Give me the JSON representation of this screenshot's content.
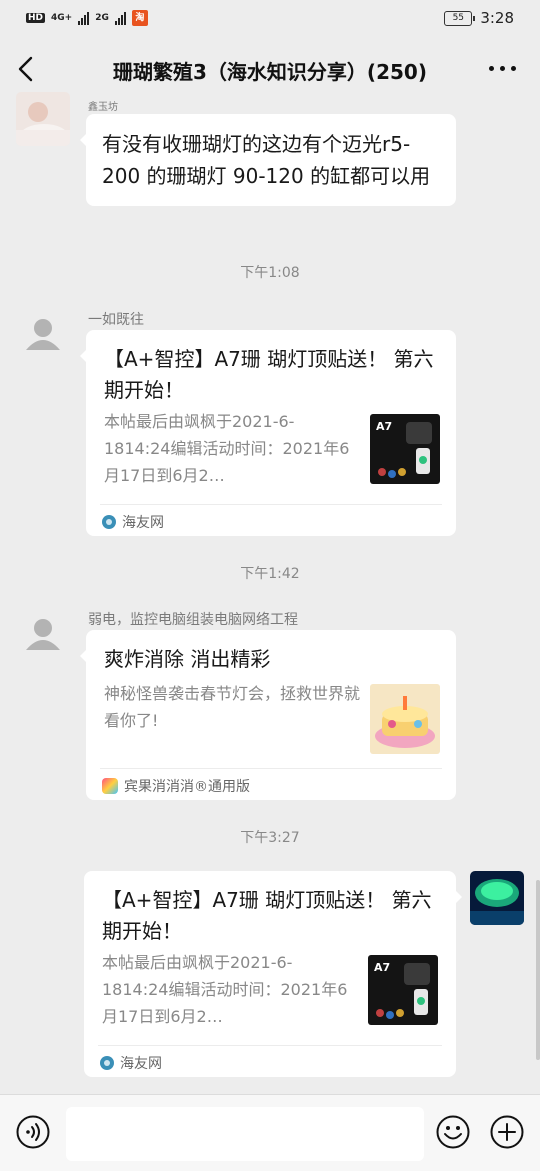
{
  "status_bar": {
    "hd_label": "HD",
    "net1": "4G+",
    "net2": "2G",
    "battery": "55",
    "time": "3:28"
  },
  "header": {
    "title": "珊瑚繁殖3（海水知识分享）(250)",
    "back_icon": "back-arrow-icon",
    "more_icon": "more-dots-icon"
  },
  "messages": [
    {
      "type": "text",
      "sender_name": "鑫玉坊",
      "text": "有没有收珊瑚灯的这边有个迈光r5-200 的珊瑚灯 90-120 的缸都可以用"
    },
    {
      "type": "time",
      "text": "下午1:08"
    },
    {
      "type": "card",
      "sender_name": "一如既往",
      "title": "【A+智控】A7珊 瑚灯顶贴送！ 第六期开始！",
      "desc": "本帖最后由飒枫于2021-6-1814:24编辑活动时间：2021年6月17日到6月2…",
      "thumb_label": "A7",
      "source": "海友网"
    },
    {
      "type": "time",
      "text": "下午1:42"
    },
    {
      "type": "card",
      "sender_name": "弱电，监控电脑组装电脑网络工程",
      "title": "爽炸消除 消出精彩",
      "desc": "神秘怪兽袭击春节灯会，拯救世界就看你了!",
      "source": "宾果消消消®通用版"
    },
    {
      "type": "time",
      "text": "下午3:27"
    },
    {
      "type": "card",
      "sender_name": "",
      "title": "【A+智控】A7珊 瑚灯顶贴送！ 第六期开始！",
      "desc": "本帖最后由飒枫于2021-6-1814:24编辑活动时间：2021年6月17日到6月2…",
      "thumb_label": "A7",
      "source": "海友网"
    }
  ],
  "input_bar": {
    "voice_icon": "voice-icon",
    "emoji_icon": "emoji-icon",
    "plus_icon": "plus-icon",
    "placeholder": ""
  },
  "colors": {
    "background": "#ededed",
    "bubble": "#ffffff",
    "secondary_text": "#888888"
  }
}
